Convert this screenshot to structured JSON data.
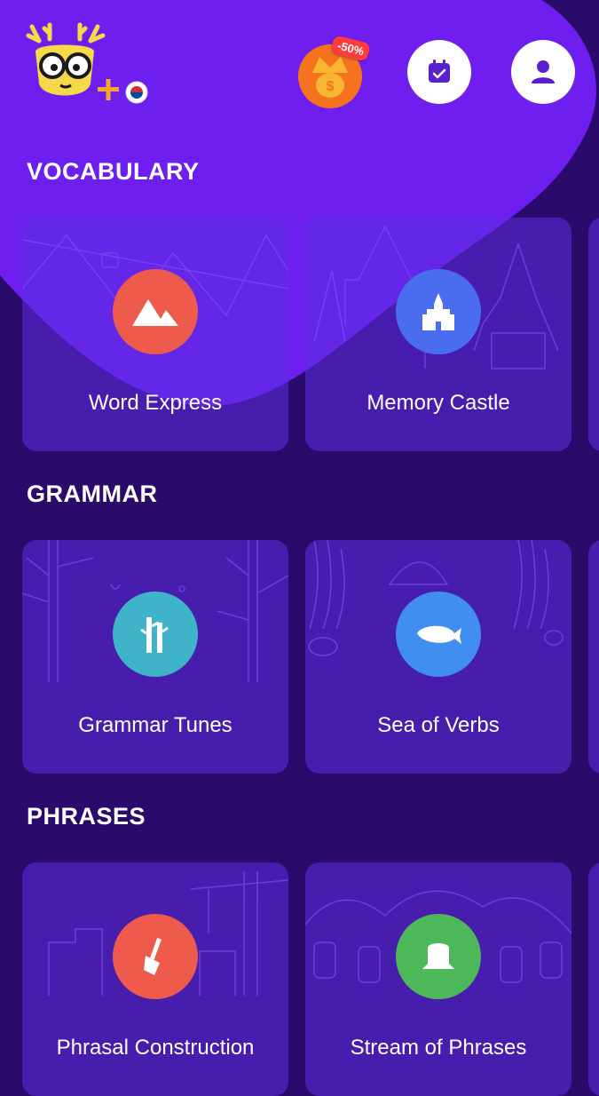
{
  "promo": {
    "discount_badge": "-50%"
  },
  "colors": {
    "background": "#2a0a6a",
    "header": "#6e1ff0",
    "card": "#4b1fc7",
    "word_express": "#ee5a4b",
    "memory_castle": "#4a6df0",
    "grammar_tunes": "#3fb4c9",
    "sea_of_verbs": "#3f8ef0",
    "phrasal_construction": "#ee5a4b",
    "stream_of_phrases": "#4db85a"
  },
  "sections": [
    {
      "title": "VOCABULARY",
      "cards": [
        {
          "label": "Word Express",
          "icon": "mountains-icon"
        },
        {
          "label": "Memory Castle",
          "icon": "castle-icon"
        }
      ]
    },
    {
      "title": "GRAMMAR",
      "cards": [
        {
          "label": "Grammar Tunes",
          "icon": "trees-icon"
        },
        {
          "label": "Sea of Verbs",
          "icon": "whale-icon"
        }
      ]
    },
    {
      "title": "PHRASES",
      "cards": [
        {
          "label": "Phrasal Construction",
          "icon": "shovel-icon"
        },
        {
          "label": "Stream of Phrases",
          "icon": "stump-icon"
        }
      ]
    }
  ]
}
